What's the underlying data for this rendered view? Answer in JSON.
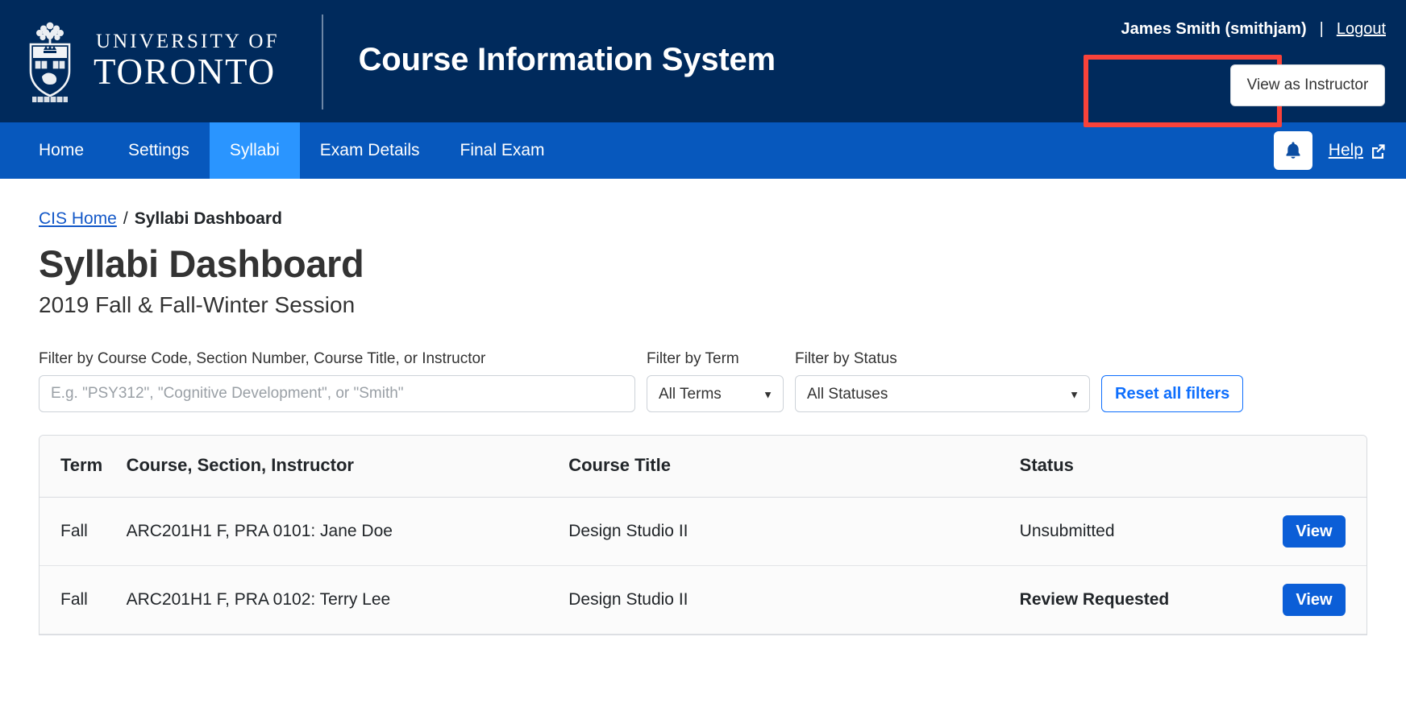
{
  "header": {
    "logo": {
      "line1": "UNIVERSITY OF",
      "line2": "TORONTO",
      "icon": "uoft-crest-icon"
    },
    "app_title": "Course Information System",
    "account_name": "James Smith (smithjam)",
    "account_separator": "|",
    "logout_label": "Logout",
    "view_as_instructor_label": "View as Instructor",
    "colors": {
      "header_bg": "#002a5c",
      "annotation": "#f9423a"
    }
  },
  "nav": {
    "items": [
      {
        "label": "Home",
        "active": false
      },
      {
        "label": "Settings",
        "active": false
      },
      {
        "label": "Syllabi",
        "active": true
      },
      {
        "label": "Exam Details",
        "active": false
      },
      {
        "label": "Final Exam",
        "active": false
      }
    ],
    "notifications_icon": "bell-icon",
    "help_label": "Help",
    "help_icon": "external-link-icon",
    "colors": {
      "nav_bg": "#0758bd",
      "active_tab": "#2a95ff"
    }
  },
  "breadcrumb": {
    "home_label": "CIS Home",
    "separator": "/",
    "current_label": "Syllabi Dashboard"
  },
  "page": {
    "title": "Syllabi Dashboard",
    "subtitle": "2019 Fall & Fall-Winter Session"
  },
  "filters": {
    "search_label": "Filter by Course Code, Section Number, Course Title, or Instructor",
    "search_placeholder": "E.g. \"PSY312\", \"Cognitive Development\", or \"Smith\"",
    "search_value": "",
    "term_label": "Filter by Term",
    "term_selected": "All Terms",
    "term_options": [
      "All Terms"
    ],
    "status_label": "Filter by Status",
    "status_selected": "All Statuses",
    "status_options": [
      "All Statuses"
    ],
    "reset_label": "Reset all filters",
    "caret_glyph": "▼"
  },
  "table": {
    "columns": [
      "Term",
      "Course, Section, Instructor",
      "Course Title",
      "Status",
      ""
    ],
    "rows": [
      {
        "term": "Fall",
        "course": "ARC201H1 F, PRA 0101: Jane Doe",
        "title": "Design Studio II",
        "status": "Unsubmitted",
        "status_bold": false,
        "action_label": "View"
      },
      {
        "term": "Fall",
        "course": "ARC201H1 F, PRA 0102: Terry Lee",
        "title": "Design Studio II",
        "status": "Review Requested",
        "status_bold": true,
        "action_label": "View"
      }
    ]
  }
}
